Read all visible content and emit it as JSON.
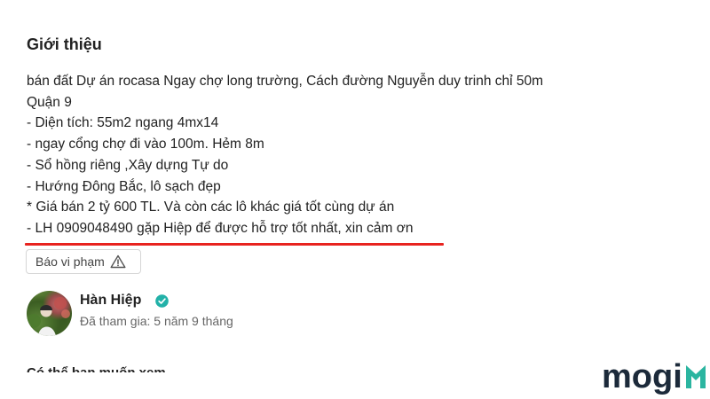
{
  "section": {
    "title": "Giới thiệu"
  },
  "description": {
    "lines": [
      "bán đất Dự án rocasa Ngay chợ long trường, Cách đường Nguyễn duy trinh chỉ 50m",
      "Quận 9",
      "- Diện tích: 55m2 ngang 4mx14",
      "- ngay cổng chợ đi vào 100m. Hẻm 8m",
      "- Sổ hồng riêng ,Xây dựng Tự do",
      "- Hướng Đông Bắc, lô sạch đẹp",
      "* Giá bán 2 tỷ 600 TL. Và còn các lô khác giá tốt cùng dự án",
      "- LH 0909048490 gặp Hiệp để được hỗ trợ tốt nhất, xin cảm ơn"
    ],
    "highlight_color": "#e8231f"
  },
  "report": {
    "label": "Báo vi phạm",
    "icon": "warning-triangle-icon"
  },
  "user": {
    "name": "Hàn Hiệp",
    "verified_icon": "verified-check-icon",
    "verified_color": "#22b1a8",
    "joined": "Đã tham gia: 5 năm 9 tháng"
  },
  "next_section": {
    "title": "Có thể bạn muốn xem"
  },
  "brand": {
    "logo_text": "mogi",
    "accent_color": "#2bb5a0"
  }
}
